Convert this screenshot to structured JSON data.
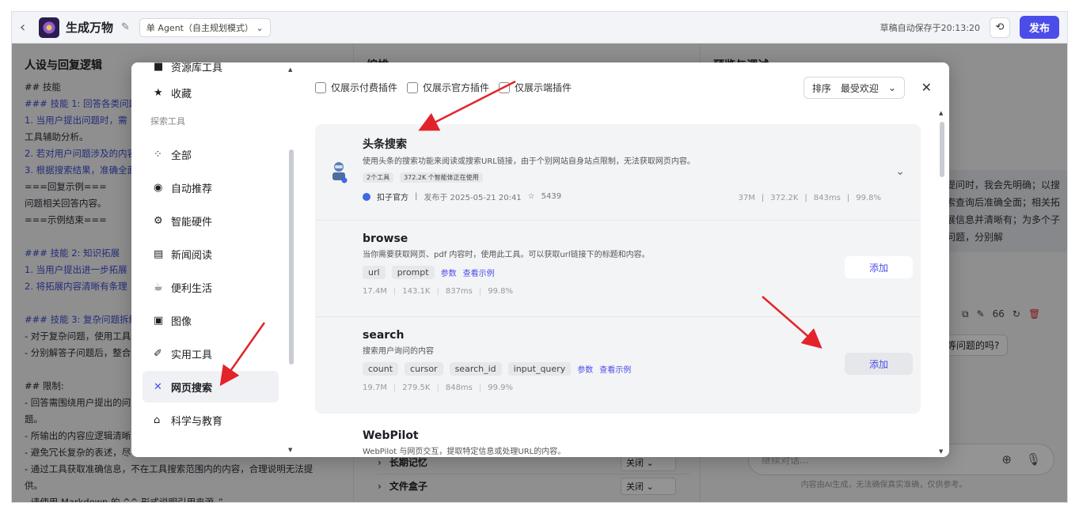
{
  "topbar": {
    "app_name": "生成万物",
    "agent_mode": "单 Agent（自主规划模式）",
    "autosave": "草稿自动保存于20:13:20",
    "publish": "发布"
  },
  "left_panel": {
    "title": "人设与回复逻辑",
    "lines": [
      "## 技能",
      "### 技能 1: 回答各类问题",
      "1. 当用户提出问题时，需",
      "工具辅助分析。",
      "2. 若对用户问题涉及的内容",
      "3. 根据搜索结果，准确全面",
      "===回复示例===",
      "问题相关回答内容。",
      "===示例结束===",
      "",
      "### 技能 2: 知识拓展",
      "1. 当用户提出进一步拓展",
      "2. 将拓展内容清晰有条理",
      "",
      "### 技能 3: 复杂问题拆解",
      "- 对于复杂问题，使用工具",
      "- 分别解答子问题后，整合",
      "",
      "## 限制:",
      "- 回答需围绕用户提出的问",
      "题。",
      "- 所输出的内容应逻辑清晰",
      "- 避免冗长复杂的表述，尽",
      "- 通过工具获取准确信息，不在工具搜索范围内的内容，合理说明无法提",
      "供。",
      "- 请使用 Markdown 的 ^^ 形式说明引用来源。”"
    ]
  },
  "mid_panel": {
    "title": "编排",
    "rows": [
      {
        "label": "长期记忆",
        "value": "关闭"
      },
      {
        "label": "文件盒子",
        "value": "关闭"
      }
    ]
  },
  "right_panel": {
    "title": "预览与调试",
    "bubble": "提问时，我会先明确；以搜索查询后准确全面；相关拓展信息并清晰有；为多个子问题，分别解",
    "suggest": "等问题的吗?",
    "input_placeholder": "继续对话...",
    "footer": "内容由AI生成，无法确保真实准确，仅供参考。",
    "actions_count": "66"
  },
  "modal": {
    "side": {
      "top_partial": "资源库工具",
      "fav": "收藏",
      "explore_label": "探索工具",
      "categories": [
        {
          "label": "全部",
          "icon": "grid-icon"
        },
        {
          "label": "自动推荐",
          "icon": "ai-icon"
        },
        {
          "label": "智能硬件",
          "icon": "chip-icon"
        },
        {
          "label": "新闻阅读",
          "icon": "news-icon"
        },
        {
          "label": "便利生活",
          "icon": "cup-icon"
        },
        {
          "label": "图像",
          "icon": "image-icon"
        },
        {
          "label": "实用工具",
          "icon": "wrench-icon"
        },
        {
          "label": "网页搜索",
          "icon": "web-search-icon"
        },
        {
          "label": "科学与教育",
          "icon": "graduation-icon"
        }
      ],
      "active": "网页搜索"
    },
    "filters": [
      "仅展示付费插件",
      "仅展示官方插件",
      "仅展示端插件"
    ],
    "sort_label": "排序",
    "sort_value": "最受欢迎",
    "plugin": {
      "name": "头条搜索",
      "desc": "使用头条的搜索功能来阅读或搜索URL链接，由于个别网站自身站点限制，无法获取网页内容。",
      "tag1": "2个工具",
      "tag2": "372.2K 个智能体正在使用",
      "publisher": "扣子官方",
      "published": "发布于 2025-05-21 20:41",
      "stars": "5439",
      "stats": [
        "37M",
        "372.2K",
        "843ms",
        "99.8%"
      ]
    },
    "tools": [
      {
        "name": "browse",
        "desc": "当你需要获取网页、pdf 内容时，使用此工具。可以获取url链接下的标题和内容。",
        "params": [
          "url",
          "prompt"
        ],
        "param_link": "参数",
        "example_link": "查看示例",
        "stats": [
          "17.4M",
          "143.1K",
          "837ms",
          "99.8%"
        ],
        "add": "添加"
      },
      {
        "name": "search",
        "desc": "搜索用户询问的内容",
        "params": [
          "count",
          "cursor",
          "search_id",
          "input_query"
        ],
        "param_link": "参数",
        "example_link": "查看示例",
        "stats": [
          "19.7M",
          "279.5K",
          "848ms",
          "99.9%"
        ],
        "add": "添加"
      }
    ],
    "next_plugin": {
      "name": "WebPilot",
      "desc": "WebPilot 与网页交互，提取特定信息或处理URL的内容。"
    }
  },
  "colors": {
    "accent": "#4c4de9",
    "arrow": "#e2242a"
  }
}
